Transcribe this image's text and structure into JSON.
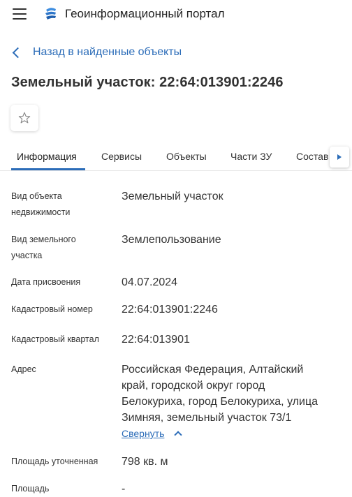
{
  "header": {
    "title": "Геоинформационный портал",
    "accent": "#2b6cb8"
  },
  "back": {
    "label": "Назад в найденные объекты"
  },
  "page": {
    "title": "Земельный участок: 22:64:013901:2246"
  },
  "tabs": [
    {
      "label": "Информация",
      "active": true
    },
    {
      "label": "Сервисы"
    },
    {
      "label": "Объекты"
    },
    {
      "label": "Части ЗУ"
    },
    {
      "label": "Состав"
    }
  ],
  "properties": [
    {
      "label": "Вид объекта недвижимости",
      "value": "Земельный участок"
    },
    {
      "label": "Вид земельного участка",
      "value": "Землепользование"
    },
    {
      "label": "Дата присвоения",
      "value": "04.07.2024"
    },
    {
      "label": "Кадастровый номер",
      "value": "22:64:013901:2246"
    },
    {
      "label": "Кадастровый квартал",
      "value": "22:64:013901"
    },
    {
      "label": "Адрес",
      "value": "Российская Федерация, Алтайский край, городской округ город Белокуриха, город Белокуриха, улица Зимняя, земельный участок 73/1"
    },
    {
      "label": "Площадь уточненная",
      "value": "798 кв. м"
    },
    {
      "label": "Площадь",
      "value": "-"
    }
  ],
  "address_toggle": {
    "label": "Свернуть"
  }
}
